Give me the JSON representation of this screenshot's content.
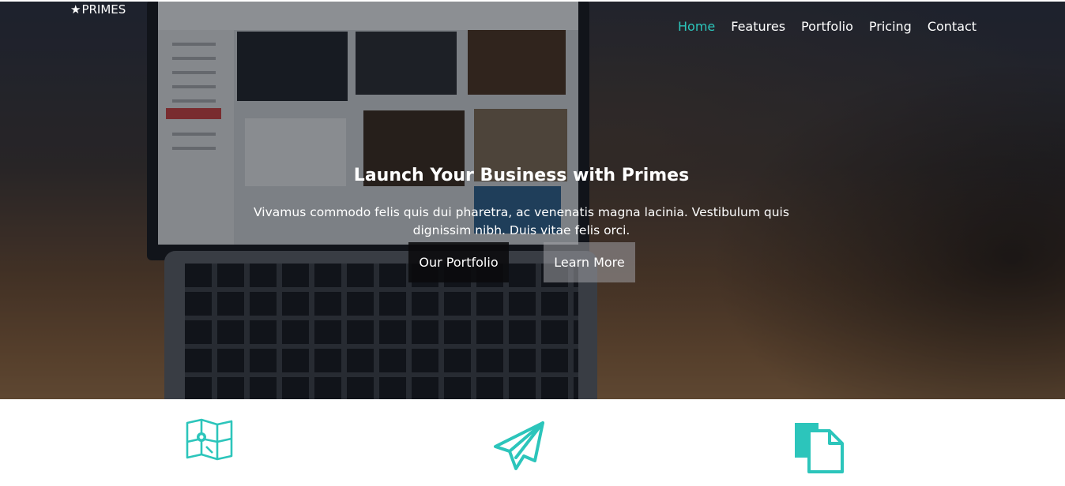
{
  "brand": {
    "name": "PRIMES",
    "icon": "star-icon"
  },
  "nav": {
    "items": [
      {
        "label": "Home",
        "active": true
      },
      {
        "label": "Features",
        "active": false
      },
      {
        "label": "Portfolio",
        "active": false
      },
      {
        "label": "Pricing",
        "active": false
      },
      {
        "label": "Contact",
        "active": false
      }
    ]
  },
  "hero": {
    "title": "Launch Your Business with Primes",
    "subtitle": "Vivamus commodo felis quis dui pharetra, ac venenatis magna lacinia. Vestibulum quis dignissim nibh. Duis vitae felis orci.",
    "buttons": {
      "primary": "Our Portfolio",
      "secondary": "Learn More"
    }
  },
  "features": {
    "icons": [
      "map-icon",
      "paper-plane-icon",
      "documents-icon"
    ],
    "accent_color": "#2cc5bb"
  },
  "colors": {
    "accent": "#2cc5bb",
    "text_light": "#ffffff"
  }
}
